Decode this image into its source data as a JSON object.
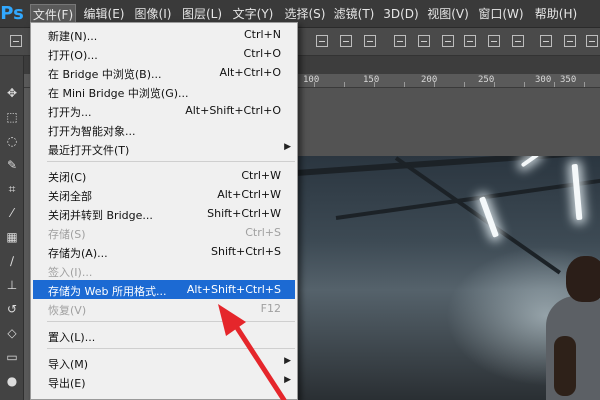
{
  "app": {
    "logo": "Ps"
  },
  "menubar": {
    "items": [
      "文件(F)",
      "编辑(E)",
      "图像(I)",
      "图层(L)",
      "文字(Y)",
      "选择(S)",
      "滤镜(T)",
      "3D(D)",
      "视图(V)",
      "窗口(W)",
      "帮助(H)"
    ],
    "active": "文件(F)"
  },
  "ruler": {
    "labels": [
      "100",
      "150",
      "200",
      "250",
      "300",
      "350"
    ]
  },
  "file_menu": {
    "items": [
      {
        "label": "新建(N)...",
        "shortcut": "Ctrl+N"
      },
      {
        "label": "打开(O)...",
        "shortcut": "Ctrl+O"
      },
      {
        "label": "在 Bridge 中浏览(B)...",
        "shortcut": "Alt+Ctrl+O"
      },
      {
        "label": "在 Mini Bridge 中浏览(G)...",
        "shortcut": ""
      },
      {
        "label": "打开为...",
        "shortcut": "Alt+Shift+Ctrl+O"
      },
      {
        "label": "打开为智能对象...",
        "shortcut": ""
      },
      {
        "label": "最近打开文件(T)",
        "shortcut": ""
      },
      {
        "label": "关闭(C)",
        "shortcut": "Ctrl+W"
      },
      {
        "label": "关闭全部",
        "shortcut": "Alt+Ctrl+W"
      },
      {
        "label": "关闭并转到 Bridge...",
        "shortcut": "Shift+Ctrl+W"
      },
      {
        "label": "存储(S)",
        "shortcut": "Ctrl+S"
      },
      {
        "label": "存储为(A)...",
        "shortcut": "Shift+Ctrl+S"
      },
      {
        "label": "签入(I)...",
        "shortcut": ""
      },
      {
        "label": "存储为 Web 所用格式...",
        "shortcut": "Alt+Shift+Ctrl+S"
      },
      {
        "label": "恢复(V)",
        "shortcut": "F12"
      },
      {
        "label": "置入(L)...",
        "shortcut": ""
      },
      {
        "label": "导入(M)",
        "shortcut": ""
      },
      {
        "label": "导出(E)",
        "shortcut": ""
      }
    ],
    "disabled": [
      "存储(S)",
      "签入(I)...",
      "恢复(V)"
    ],
    "highlighted": "存储为 Web 所用格式...",
    "submenus": [
      "最近打开文件(T)",
      "导入(M)",
      "导出(E)"
    ]
  },
  "colors": {
    "menubar": "#3a3a3a",
    "highlight": "#1c6ad3",
    "annotation_arrow": "#e5262b",
    "ps_logo": "#31a8ff"
  },
  "icons": [
    "move-tool-icon",
    "marquee-tool-icon",
    "lasso-tool-icon",
    "quick-select-tool-icon",
    "crop-tool-icon",
    "eyedropper-tool-icon",
    "healing-brush-tool-icon",
    "brush-tool-icon",
    "clone-stamp-tool-icon",
    "history-brush-tool-icon",
    "eraser-tool-icon",
    "gradient-tool-icon",
    "blur-tool-icon",
    "submenu-arrow-icon"
  ]
}
